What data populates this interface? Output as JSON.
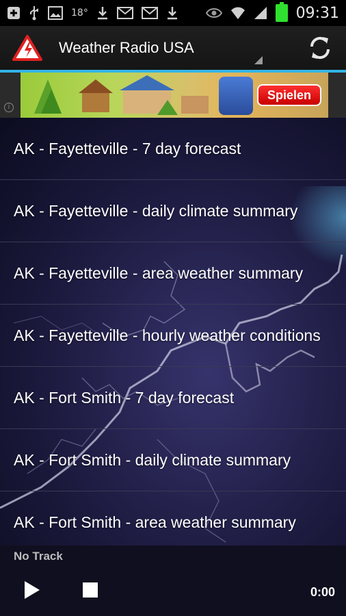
{
  "status_bar": {
    "temperature": "18°",
    "time": "09:31",
    "icons": [
      "add-box-icon",
      "usb-icon",
      "image-icon",
      "download-icon",
      "mail-icon",
      "mail-icon",
      "download-icon",
      "eye-icon",
      "wifi-icon",
      "signal-icon",
      "battery-icon"
    ]
  },
  "action_bar": {
    "title": "Weather Radio USA",
    "app_icon": "warning-lightning-icon",
    "refresh_icon": "refresh-icon",
    "accent_color": "#33b5e5"
  },
  "ad": {
    "button_label": "Spielen",
    "info_label": "i"
  },
  "stations": [
    {
      "label": "AK - Fayetteville - 7 day forecast"
    },
    {
      "label": "AK - Fayetteville - daily climate summary"
    },
    {
      "label": "AK - Fayetteville - area weather summary"
    },
    {
      "label": "AK - Fayetteville - hourly weather conditions"
    },
    {
      "label": "AK - Fort Smith - 7 day forecast"
    },
    {
      "label": "AK - Fort Smith - daily climate summary"
    },
    {
      "label": "AK - Fort Smith - area weather summary"
    }
  ],
  "player": {
    "track": "No Track",
    "time": "0:00"
  }
}
